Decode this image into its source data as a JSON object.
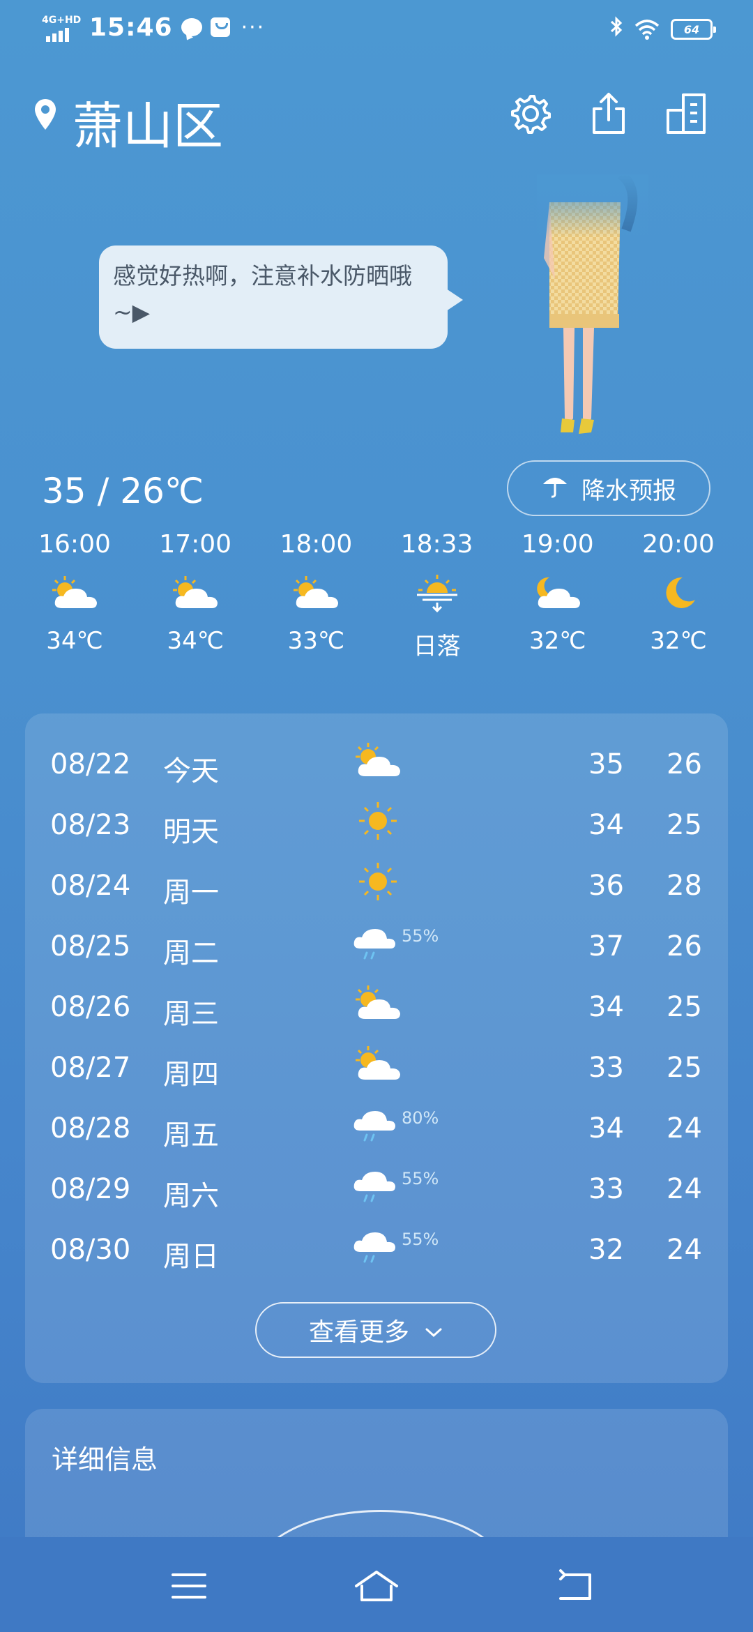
{
  "status_bar": {
    "network": "4G+HD",
    "time": "15:46",
    "dots": "···",
    "battery": "64"
  },
  "header": {
    "location": "萧山区"
  },
  "bubble": {
    "text": "感觉好热啊，注意补水防晒哦~▶"
  },
  "today": {
    "temp_range": "35 / 26℃"
  },
  "precip_button": {
    "label": "降水预报"
  },
  "hourly": [
    {
      "time": "16:00",
      "icon": "sun-cloud",
      "value": "34℃"
    },
    {
      "time": "17:00",
      "icon": "sun-cloud",
      "value": "34℃"
    },
    {
      "time": "18:00",
      "icon": "sun-cloud",
      "value": "33℃"
    },
    {
      "time": "18:33",
      "icon": "sunset",
      "value": "日落"
    },
    {
      "time": "19:00",
      "icon": "moon-cloud",
      "value": "32℃"
    },
    {
      "time": "20:00",
      "icon": "moon",
      "value": "32℃"
    }
  ],
  "daily": [
    {
      "date": "08/22",
      "weekday": "今天",
      "icon": "sun-cloud",
      "pop": "",
      "high": "35",
      "low": "26"
    },
    {
      "date": "08/23",
      "weekday": "明天",
      "icon": "sun",
      "pop": "",
      "high": "34",
      "low": "25"
    },
    {
      "date": "08/24",
      "weekday": "周一",
      "icon": "sun",
      "pop": "",
      "high": "36",
      "low": "28"
    },
    {
      "date": "08/25",
      "weekday": "周二",
      "icon": "rain",
      "pop": "55%",
      "high": "37",
      "low": "26"
    },
    {
      "date": "08/26",
      "weekday": "周三",
      "icon": "sun-cloud",
      "pop": "",
      "high": "34",
      "low": "25"
    },
    {
      "date": "08/27",
      "weekday": "周四",
      "icon": "sun-cloud",
      "pop": "",
      "high": "33",
      "low": "25"
    },
    {
      "date": "08/28",
      "weekday": "周五",
      "icon": "rain",
      "pop": "80%",
      "high": "34",
      "low": "24"
    },
    {
      "date": "08/29",
      "weekday": "周六",
      "icon": "rain",
      "pop": "55%",
      "high": "33",
      "low": "24"
    },
    {
      "date": "08/30",
      "weekday": "周日",
      "icon": "rain",
      "pop": "55%",
      "high": "32",
      "low": "24"
    }
  ],
  "more_button": {
    "label": "查看更多"
  },
  "detail": {
    "title": "详细信息"
  },
  "colors": {
    "sun": "#f6b820",
    "cloud": "#ffffff",
    "rain": "#6ec3f2",
    "moon": "#f6b820"
  }
}
